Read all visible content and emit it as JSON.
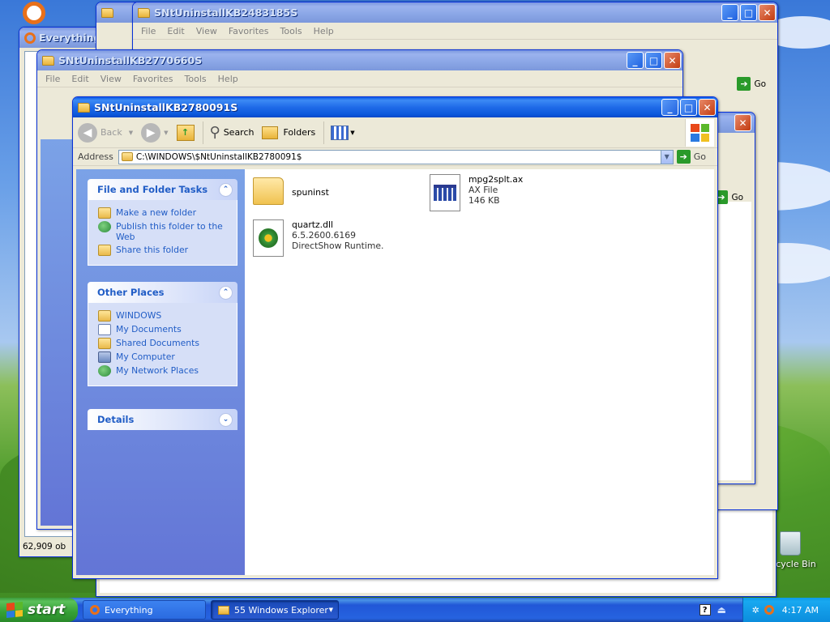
{
  "desktop": {
    "recycle_bin_label": "Recycle Bin"
  },
  "everything_window": {
    "title": "Everything",
    "status": "62,909 ob"
  },
  "bg_window_1": {
    "title": "SNtUninstallKB2483185S",
    "menu": [
      "File",
      "Edit",
      "View",
      "Favorites",
      "Tools",
      "Help"
    ],
    "go_label": "Go"
  },
  "bg_window_2": {
    "title": "SNtUninstallKB2770660S",
    "menu": [
      "File",
      "Edit",
      "View",
      "Favorites",
      "Tools",
      "Help"
    ],
    "go_label": "Go"
  },
  "main_window": {
    "title": "SNtUninstallKB2780091S",
    "toolbar": {
      "back_label": "Back",
      "search_label": "Search",
      "folders_label": "Folders"
    },
    "address": {
      "label": "Address",
      "value": "C:\\WINDOWS\\$NtUninstallKB2780091$",
      "go_label": "Go"
    },
    "tasks_panel": {
      "title": "File and Folder Tasks",
      "items": [
        "Make a new folder",
        "Publish this folder to the Web",
        "Share this folder"
      ]
    },
    "other_places": {
      "title": "Other Places",
      "items": [
        "WINDOWS",
        "My Documents",
        "Shared Documents",
        "My Computer",
        "My Network Places"
      ]
    },
    "details": {
      "title": "Details"
    },
    "files": [
      {
        "name": "spuninst",
        "type": "folder"
      },
      {
        "name": "mpg2splt.ax",
        "line2": "AX File",
        "line3": "146 KB"
      },
      {
        "name": "quartz.dll",
        "line2": "6.5.2600.6169",
        "line3": "DirectShow Runtime."
      }
    ]
  },
  "taskbar": {
    "start_label": "start",
    "tasks": [
      "Everything",
      "55 Windows Explorer"
    ],
    "clock": "4:17 AM"
  },
  "colors": {
    "title_active": "#0a5ae6",
    "title_inactive": "#8aa6e6",
    "link": "#215dc6",
    "taskbar": "#2663e0",
    "start": "#35a035"
  }
}
